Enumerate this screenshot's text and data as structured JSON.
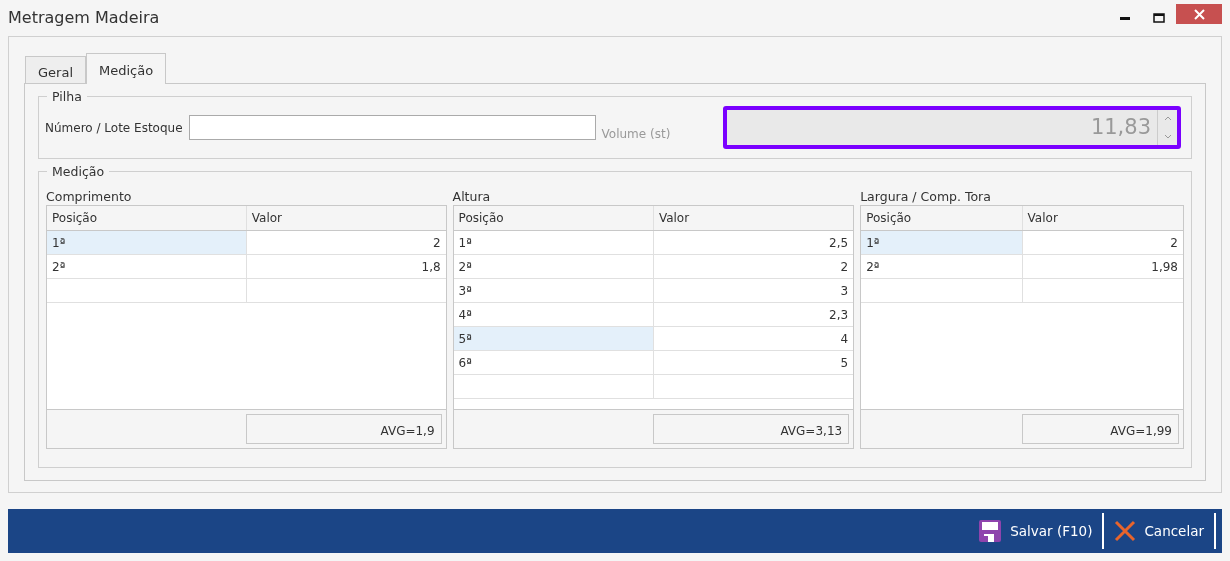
{
  "window": {
    "title": "Metragem Madeira"
  },
  "tabs": [
    {
      "label": "Geral",
      "selected": false
    },
    {
      "label": "Medição",
      "selected": true
    }
  ],
  "pilha": {
    "legend": "Pilha",
    "lote_label": "Número / Lote Estoque",
    "volume_label": "Volume (st)",
    "volume_value": "11,83"
  },
  "medicao": {
    "legend": "Medição",
    "grids": [
      {
        "title": "Comprimento",
        "columns": [
          "Posição",
          "Valor"
        ],
        "rows": [
          {
            "posicao": "1ª",
            "valor": "2",
            "selected": true
          },
          {
            "posicao": "2ª",
            "valor": "1,8",
            "selected": false
          }
        ],
        "footer": "AVG=1,9"
      },
      {
        "title": "Altura",
        "columns": [
          "Posição",
          "Valor"
        ],
        "rows": [
          {
            "posicao": "1ª",
            "valor": "2,5",
            "selected": false
          },
          {
            "posicao": "2ª",
            "valor": "2",
            "selected": false
          },
          {
            "posicao": "3ª",
            "valor": "3",
            "selected": false
          },
          {
            "posicao": "4ª",
            "valor": "2,3",
            "selected": false
          },
          {
            "posicao": "5ª",
            "valor": "4",
            "selected": true
          },
          {
            "posicao": "6ª",
            "valor": "5",
            "selected": false
          }
        ],
        "footer": "AVG=3,13"
      },
      {
        "title": "Largura / Comp. Tora",
        "columns": [
          "Posição",
          "Valor"
        ],
        "rows": [
          {
            "posicao": "1ª",
            "valor": "2",
            "selected": true
          },
          {
            "posicao": "2ª",
            "valor": "1,98",
            "selected": false
          }
        ],
        "footer": "AVG=1,99"
      }
    ]
  },
  "actions": [
    {
      "kind": "save",
      "label": "Salvar (F10)"
    },
    {
      "kind": "cancel",
      "label": "Cancelar"
    }
  ]
}
